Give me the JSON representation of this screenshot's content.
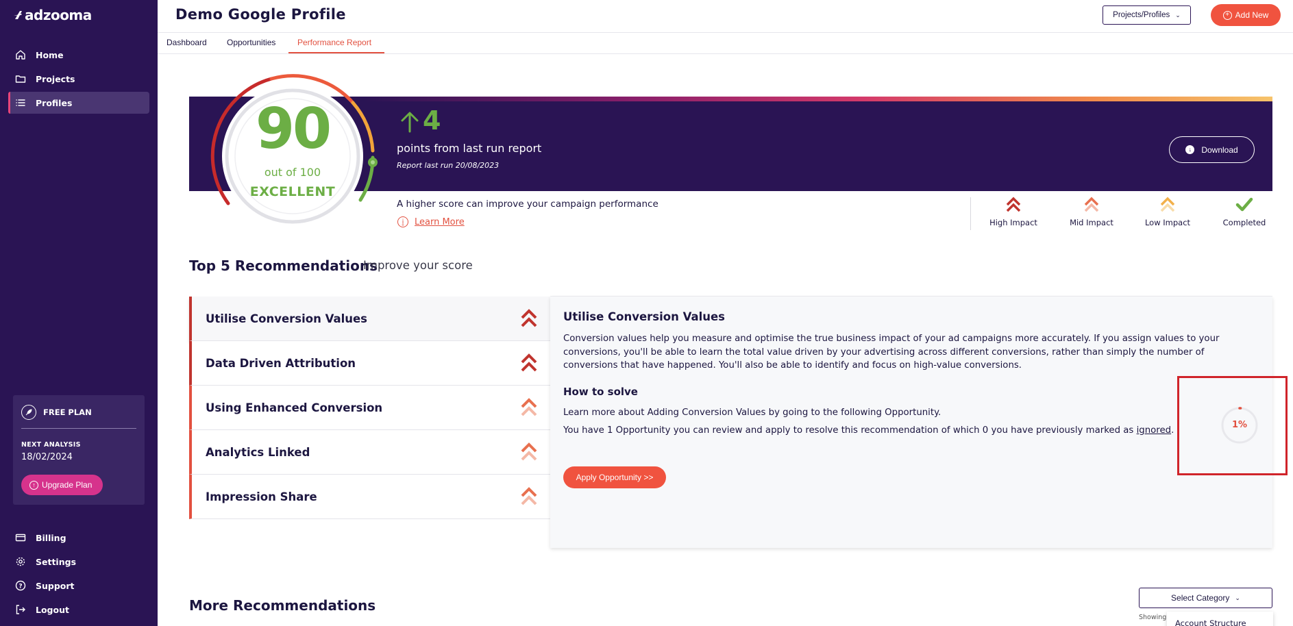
{
  "app": {
    "brand": "adzooma"
  },
  "sidebar": {
    "nav": [
      {
        "label": "Home",
        "icon": "home-icon"
      },
      {
        "label": "Projects",
        "icon": "folder-icon"
      },
      {
        "label": "Profiles",
        "icon": "list-icon",
        "active": true
      }
    ],
    "plan": {
      "name": "FREE PLAN",
      "next_label": "NEXT ANALYSIS",
      "next_date": "18/02/2024",
      "upgrade_label": "Upgrade Plan"
    },
    "bottom_nav": [
      {
        "label": "Billing",
        "icon": "card-icon"
      },
      {
        "label": "Settings",
        "icon": "gear-icon"
      },
      {
        "label": "Support",
        "icon": "help-icon"
      },
      {
        "label": "Logout",
        "icon": "logout-icon"
      }
    ]
  },
  "header": {
    "title": "Demo Google Profile",
    "project_select": "Projects/Profiles",
    "add_new": "Add New"
  },
  "tabs": [
    {
      "label": "Dashboard"
    },
    {
      "label": "Opportunities"
    },
    {
      "label": "Performance Report",
      "active": true
    }
  ],
  "score": {
    "value": "90",
    "out_of": "out of 100",
    "rating": "EXCELLENT",
    "delta": "4",
    "points_text": "points from last run report",
    "report_text": "Report last run 20/08/2023",
    "download": "Download",
    "higher_text": "A higher score can improve your campaign performance",
    "learn_more": "Learn More",
    "fraction": 0.9
  },
  "legend": [
    {
      "label": "High Impact",
      "color": "#c0342e"
    },
    {
      "label": "Mid Impact",
      "color": "#e8704f"
    },
    {
      "label": "Low Impact",
      "color": "#f2b04a"
    },
    {
      "label": "Completed",
      "color": "#6cae45"
    }
  ],
  "top5": {
    "title": "Top 5 Recommendations",
    "subtitle": "Improve your score",
    "items": [
      {
        "label": "Utilise Conversion Values",
        "impact": "high"
      },
      {
        "label": "Data Driven Attribution",
        "impact": "high"
      },
      {
        "label": "Using Enhanced Conversion",
        "impact": "mid"
      },
      {
        "label": "Analytics Linked",
        "impact": "mid"
      },
      {
        "label": "Impression Share",
        "impact": "mid"
      }
    ],
    "detail": {
      "title": "Utilise Conversion Values",
      "body": "Conversion values help you measure and optimise the true business impact of your ad campaigns more accurately. If you assign values to your conversions, you'll be able to learn the total value driven by your advertising across different conversions, rather than simply the number of conversions that have happened. You'll also be able to identify and focus on high-value conversions.",
      "how_title": "How to solve",
      "line1": "Learn more about Adding Conversion Values by going to the following Opportunity.",
      "line2_prefix": "You have 1 Opportunity you can review and apply to resolve this recommendation of which 0 you have previously marked as ",
      "line2_link": "ignored",
      "line2_suffix": ".",
      "apply": "Apply Opportunity >>",
      "progress_label": "1%",
      "progress_fraction": 0.01
    }
  },
  "more": {
    "title": "More Recommendations",
    "select_category": "Select Category",
    "showing": "Showing",
    "dropdown_first": "Account Structure"
  },
  "colors": {
    "sidebar": "#2a1454",
    "accent": "#f0533f",
    "score_green": "#6cae45",
    "upgrade_pink": "#d6338c"
  }
}
